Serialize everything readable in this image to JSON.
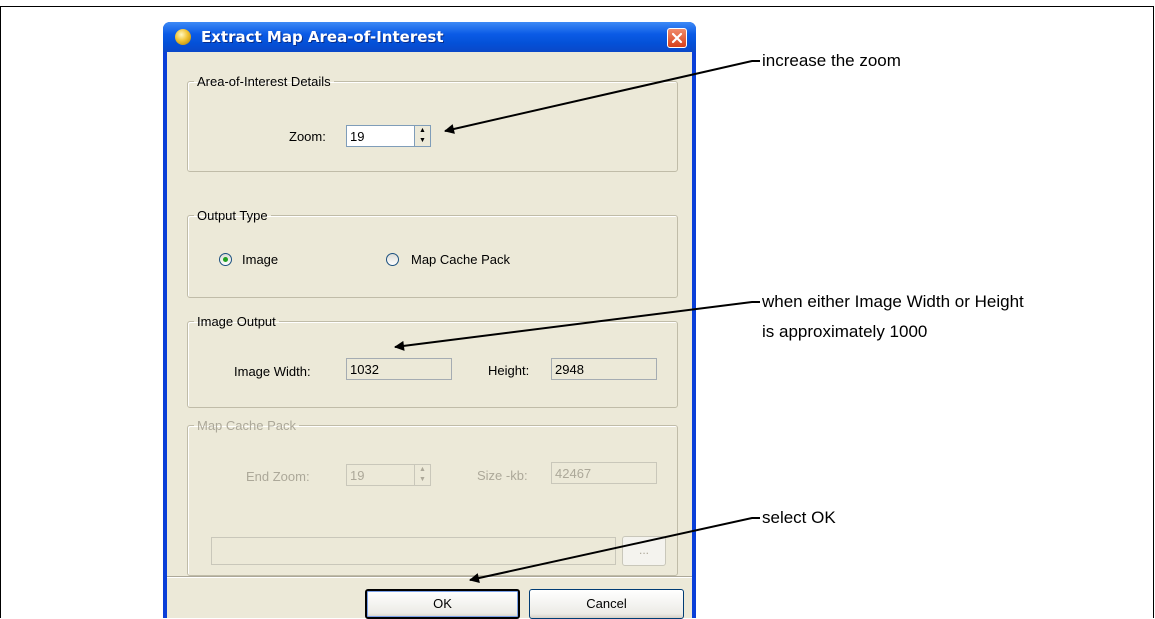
{
  "dialog": {
    "title": "Extract Map Area-of-Interest",
    "app_icon": "globe-icon",
    "close_icon": "close-icon"
  },
  "aoi_details": {
    "legend": "Area-of-Interest Details",
    "zoom_label": "Zoom:",
    "zoom_value": "19"
  },
  "output_type": {
    "legend": "Output Type",
    "options": [
      {
        "label": "Image",
        "selected": true
      },
      {
        "label": "Map Cache Pack",
        "selected": false
      }
    ]
  },
  "image_output": {
    "legend": "Image Output",
    "width_label": "Image Width:",
    "width_value": "1032",
    "height_label": "Height:",
    "height_value": "2948"
  },
  "map_cache_pack": {
    "legend": "Map Cache Pack",
    "end_zoom_label": "End Zoom:",
    "end_zoom_value": "19",
    "size_label": "Size -kb:",
    "size_value": "42467",
    "path_value": "",
    "browse_label": "..."
  },
  "buttons": {
    "ok": "OK",
    "cancel": "Cancel"
  },
  "callouts": {
    "zoom": "increase the zoom",
    "size_line1": "when either Image Width or Height",
    "size_line2": "is approximately 1000",
    "ok": "select OK"
  }
}
